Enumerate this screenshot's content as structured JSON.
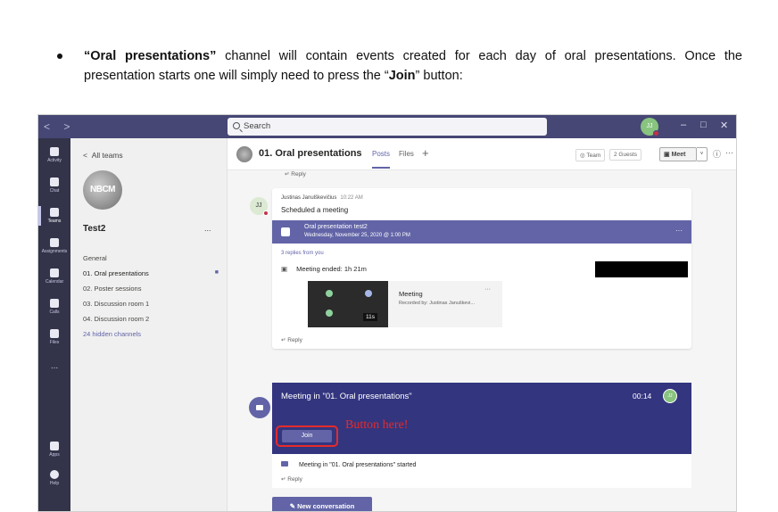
{
  "document": {
    "bullet_bold_1": "“Oral presentations”",
    "bullet_text_1": " channel will contain events created for each day of oral presentations. Once the presentation starts one will simply need to press the “",
    "bullet_bold_2": "Join",
    "bullet_text_2": "” button:"
  },
  "titlebar": {
    "back": "<",
    "forward": ">",
    "search_placeholder": "Search",
    "user_initials": "JJ",
    "minimize": "–",
    "maximize": "□",
    "close": "✕"
  },
  "rail": {
    "items": [
      {
        "label": "Activity",
        "icon": "bell-icon"
      },
      {
        "label": "Chat",
        "icon": "chat-icon"
      },
      {
        "label": "Teams",
        "icon": "teams-icon"
      },
      {
        "label": "Assignments",
        "icon": "assignments-icon"
      },
      {
        "label": "Calendar",
        "icon": "calendar-icon"
      },
      {
        "label": "Calls",
        "icon": "phone-icon"
      },
      {
        "label": "Files",
        "icon": "files-icon"
      },
      {
        "label": "...",
        "icon": "more-icon"
      },
      {
        "label": "Apps",
        "icon": "apps-icon"
      },
      {
        "label": "Help",
        "icon": "help-icon"
      }
    ]
  },
  "panel": {
    "back_label": "All teams",
    "team_logo_text": "NBCM",
    "team_name": "Test2",
    "more": "...",
    "channels": [
      {
        "label": "General"
      },
      {
        "label": "01. Oral presentations"
      },
      {
        "label": "02. Poster sessions"
      },
      {
        "label": "03. Discussion room 1"
      },
      {
        "label": "04. Discussion room 2"
      },
      {
        "label": "24 hidden channels"
      }
    ]
  },
  "header": {
    "channel_title": "01. Oral presentations",
    "tab_posts": "Posts",
    "tab_files": "Files",
    "plus": "+",
    "team_chip": "◎ Team",
    "guests_chip": "2 Guests",
    "meet_label": "Meet",
    "meet_dropdown": "˅",
    "info": "ⓘ",
    "more": "···"
  },
  "feed": {
    "reply_top": "↵ Reply",
    "post": {
      "avatar": "JJ",
      "author": "Justinas Janulškevičius",
      "time": "10:22 AM",
      "subtitle": "Scheduled a meeting",
      "event_title": "Oral presentation test2",
      "event_date": "Wednesday, November 25, 2020 @ 1:00 PM",
      "event_more": "···",
      "replies_from": "3 replies from you",
      "meeting_ended": "Meeting ended: 1h 21m",
      "recording_title": "Meeting",
      "recording_by": "Recorded by: Justinas Januškevi...",
      "recording_duration": "11s",
      "recording_more": "···",
      "reply": "↵ Reply"
    },
    "meeting": {
      "title": "Meeting in \"01. Oral presentations\"",
      "timer": "00:14",
      "avatar": "JJ",
      "join_label": "Join",
      "annotation": "Button here!",
      "started_text": "Meeting in \"01. Oral presentations\" started",
      "reply": "↵ Reply"
    },
    "new_conversation": "✎  New conversation"
  }
}
